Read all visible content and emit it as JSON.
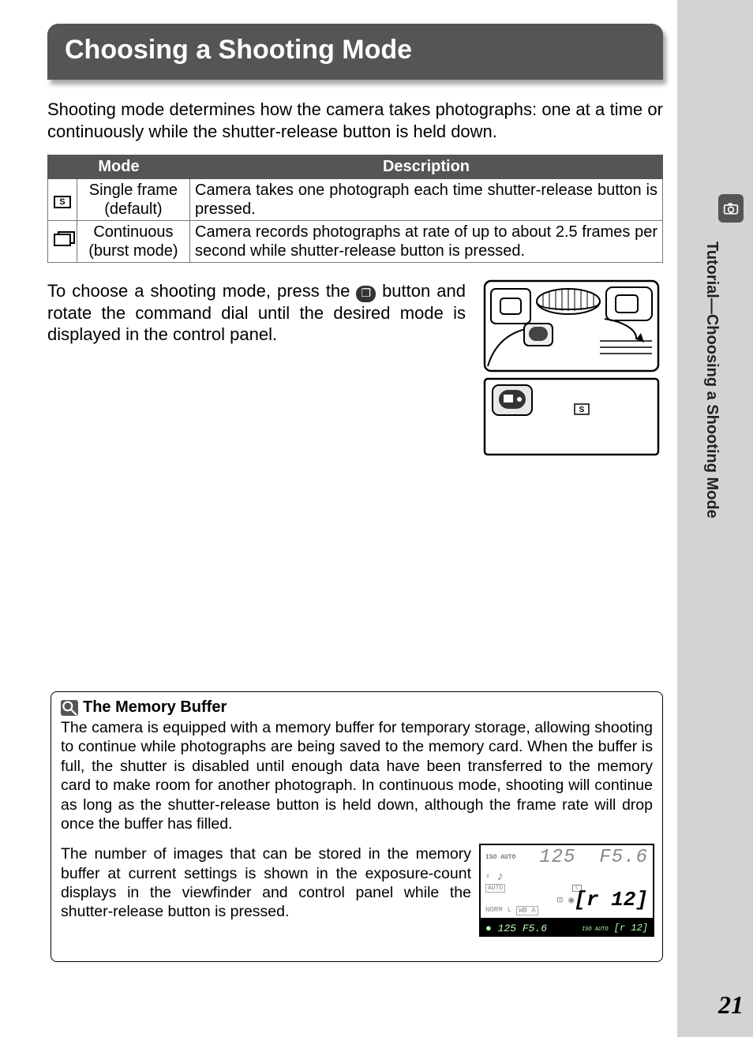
{
  "header": {
    "title": "Choosing a Shooting Mode"
  },
  "intro": "Shooting mode determines how the camera takes photographs: one at a time or continuously while the shutter-release button is held down.",
  "table": {
    "col_mode": "Mode",
    "col_desc": "Description",
    "rows": [
      {
        "icon_label": "S",
        "name": "Single frame (default)",
        "desc": "Camera takes one photograph each time shutter-release button is pressed."
      },
      {
        "icon_label": "",
        "name": "Continuous (burst mode)",
        "desc": "Camera records photographs at rate of up to about 2.5 frames per second while shutter-release button is pressed."
      }
    ]
  },
  "instruction": {
    "pre": "To choose a shooting mode, press the ",
    "button_glyph": "❐",
    "post": " button and rotate the command dial until the desired mode is displayed in the control panel."
  },
  "diagram": {
    "marker": "S"
  },
  "info": {
    "title": "The Memory Buffer",
    "body": "The camera is equipped with a memory buffer for temporary storage, allowing shooting to continue while photographs are being saved to the memory card. When the buffer is full, the shutter is disabled until enough data have been transferred to the memory card to make room for another photograph.  In continuous mode, shooting will continue as long as the shutter-release button is held down, although the frame rate will drop once the buffer has filled.",
    "second": "The number of images that can be stored in the memory buffer at current settings is shown in the exposure-count displays in the viewfinder and control panel while the shutter-release button is pressed.",
    "lcd": {
      "iso": "ISO AUTO",
      "shutter": "125",
      "aperture": "F5.6",
      "auto": "AUTO",
      "s_marker": "S",
      "remaining": "[r 12]",
      "norm": "NORM",
      "size": "L",
      "wb": "WB A"
    },
    "viewfinder": {
      "left": "125 F5.6",
      "iso_auto": "ISO AUTO",
      "right": "[r 12]"
    }
  },
  "sidebar": {
    "tab_letter": "",
    "text": "Tutorial—Choosing a Shooting Mode",
    "page": "21"
  }
}
